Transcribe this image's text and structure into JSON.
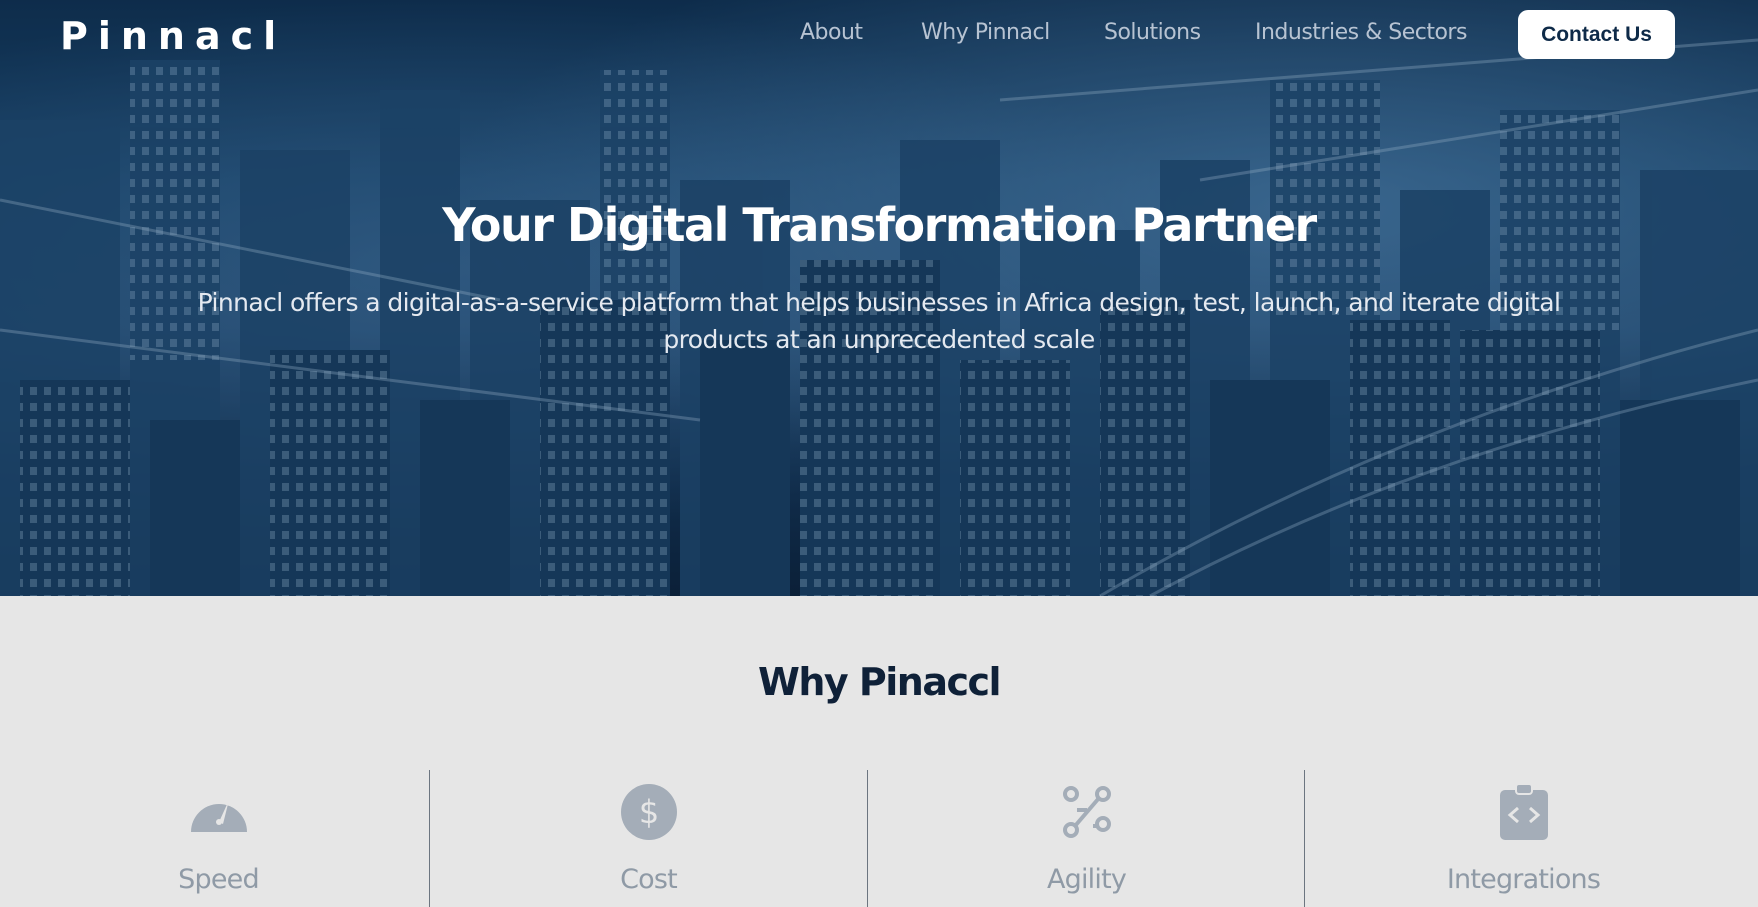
{
  "brand": {
    "logo": "Pinnacl"
  },
  "nav": {
    "about": "About",
    "why": "Why Pinnacl",
    "solutions": "Solutions",
    "industries": "Industries & Sectors",
    "contact": "Contact Us"
  },
  "hero": {
    "title": "Your Digital Transformation Partner",
    "subtitle": "Pinnacl offers a digital-as-a-service platform that helps businesses in Africa design, test, launch, and iterate digital products at an unprecedented scale"
  },
  "why_section": {
    "title": "Why Pinaccl",
    "features": [
      {
        "label": "Speed",
        "icon": "speedometer-icon"
      },
      {
        "label": "Cost",
        "icon": "dollar-icon"
      },
      {
        "label": "Agility",
        "icon": "route-icon"
      },
      {
        "label": "Integrations",
        "icon": "code-clipboard-icon"
      }
    ]
  },
  "colors": {
    "hero_base": "#1a4a73",
    "section_bg": "#e6e6e6",
    "heading": "#0f2138",
    "icon": "#a4adb8",
    "feature_label": "#8f9aa6"
  }
}
